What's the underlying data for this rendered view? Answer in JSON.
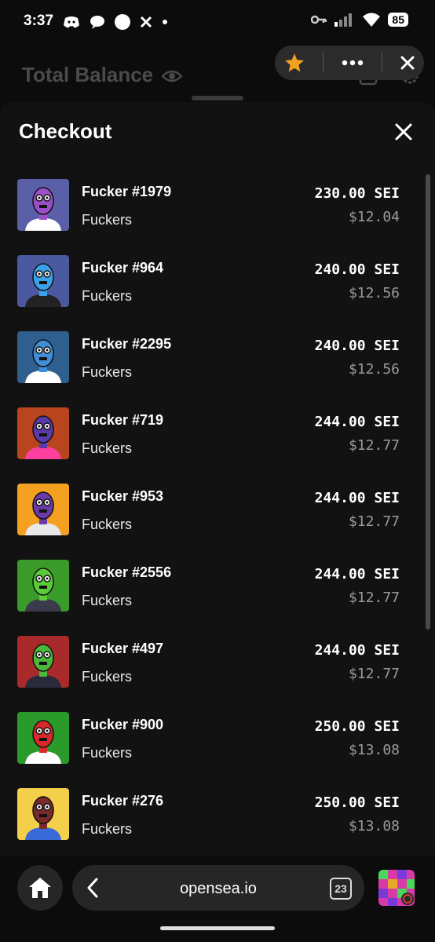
{
  "status": {
    "time": "3:37",
    "battery": "85"
  },
  "background": {
    "header_title": "Total Balance"
  },
  "sheet": {
    "title": "Checkout"
  },
  "items": [
    {
      "name": "Fucker #1979",
      "collection": "Fuckers",
      "price": "230.00 SEI",
      "usd": "$12.04",
      "bg": "#5a5fa8",
      "skin": "#9a4fc8",
      "shirt": "#ffffff"
    },
    {
      "name": "Fucker #964",
      "collection": "Fuckers",
      "price": "240.00 SEI",
      "usd": "$12.56",
      "bg": "#4b5aa0",
      "skin": "#3aa0e8",
      "shirt": "#222222"
    },
    {
      "name": "Fucker #2295",
      "collection": "Fuckers",
      "price": "240.00 SEI",
      "usd": "$12.56",
      "bg": "#2f5f8f",
      "skin": "#3f8fd8",
      "shirt": "#ffffff"
    },
    {
      "name": "Fucker #719",
      "collection": "Fuckers",
      "price": "244.00 SEI",
      "usd": "$12.77",
      "bg": "#b8451e",
      "skin": "#5a3aa8",
      "shirt": "#ff3fa0"
    },
    {
      "name": "Fucker #953",
      "collection": "Fuckers",
      "price": "244.00 SEI",
      "usd": "$12.77",
      "bg": "#f4a020",
      "skin": "#6a3aa8",
      "shirt": "#e8e8e8"
    },
    {
      "name": "Fucker #2556",
      "collection": "Fuckers",
      "price": "244.00 SEI",
      "usd": "$12.77",
      "bg": "#3a9a2a",
      "skin": "#5acc3a",
      "shirt": "#3a3a4a"
    },
    {
      "name": "Fucker #497",
      "collection": "Fuckers",
      "price": "244.00 SEI",
      "usd": "$12.77",
      "bg": "#a82a2a",
      "skin": "#4ab83a",
      "shirt": "#2a2a3a"
    },
    {
      "name": "Fucker #900",
      "collection": "Fuckers",
      "price": "250.00 SEI",
      "usd": "$13.08",
      "bg": "#2a9a2a",
      "skin": "#d82a2a",
      "shirt": "#ffffff"
    },
    {
      "name": "Fucker #276",
      "collection": "Fuckers",
      "price": "250.00 SEI",
      "usd": "$13.08",
      "bg": "#f4d04a",
      "skin": "#7a2a2a",
      "shirt": "#3a6ad8"
    }
  ],
  "browser": {
    "url": "opensea.io",
    "tab_count": "23"
  },
  "colors": {
    "accent_star": "#f4a020",
    "sheet_bg": "#121212",
    "muted_text": "#9a9a9a"
  }
}
